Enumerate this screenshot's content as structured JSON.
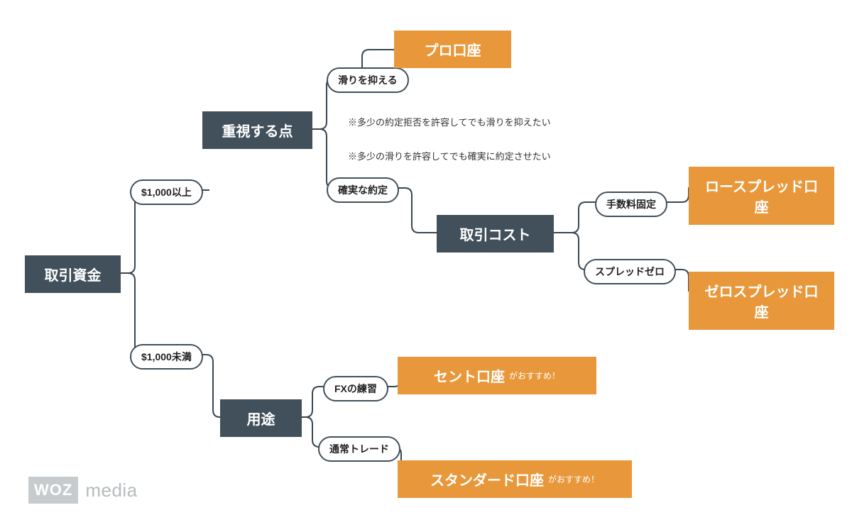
{
  "root": "取引資金",
  "pill_over_1000": "$1,000以上",
  "pill_under_1000": "$1,000未満",
  "node_focus": "重視する点",
  "node_usage": "用途",
  "pill_reduce_slip": "滑りを抑える",
  "pill_sure_exec": "確実な約定",
  "pill_fx_practice": "FXの練習",
  "pill_normal_trade": "通常トレード",
  "note_slip": "※多少の約定拒否を許容してでも滑りを抑えたい",
  "note_exec": "※多少の滑りを許容してでも確実に約定させたい",
  "node_cost": "取引コスト",
  "pill_fee_fixed": "手数料固定",
  "pill_spread_zero": "スプレッドゼロ",
  "result_pro": "プロ口座",
  "result_lowspread": "ロースプレッド口座",
  "result_zerospread": "ゼロスプレッド口座",
  "result_cent": "セント口座",
  "result_cent_suffix": "がおすすめ！",
  "result_standard": "スタンダード口座",
  "result_standard_suffix": "がおすすめ！",
  "logo_mark": "WOZ",
  "logo_text": "media"
}
